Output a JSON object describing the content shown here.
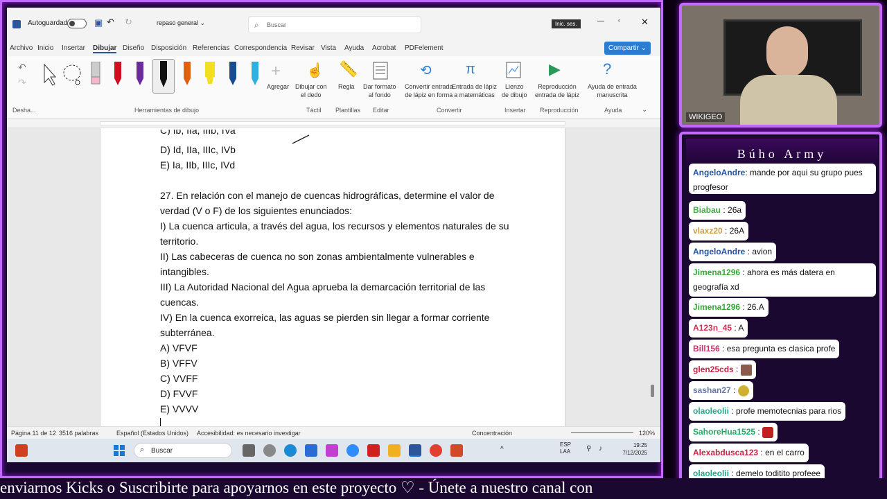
{
  "word": {
    "autosave_label": "Autoguardado",
    "doc_title": "repaso general",
    "search_placeholder": "Buscar",
    "signin_label": "Inic. ses.",
    "share_label": "Compartir",
    "menu": [
      "Archivo",
      "Inicio",
      "Insertar",
      "Dibujar",
      "Diseño",
      "Disposición",
      "Referencias",
      "Correspondencia",
      "Revisar",
      "Vista",
      "Ayuda",
      "Acrobat",
      "PDFelement"
    ],
    "ribbon": {
      "undo_group": "Desha...",
      "tools_group": "Herramientas de dibujo",
      "add_label": "Agregar",
      "draw_finger": "Dibujar con\nel dedo",
      "ruler_label": "Regla",
      "format_bg": "Dar formato\nal fondo",
      "convert_shape": "Convertir entrada\nde lápiz en forma",
      "math_input": "Entrada de lápiz\na matemáticas",
      "canvas": "Lienzo\nde dibujo",
      "replay": "Reproducción\nentrada de lápiz",
      "help_input": "Ayuda de entrada\nmanuscrita",
      "groups": [
        "Táctil",
        "Plantillas",
        "Editar",
        "Convertir",
        "Insertar",
        "Reproducción",
        "Ayuda"
      ]
    },
    "doc_lines": [
      "D) Id, IIa, IIIc, IVb",
      "E) Ia, IIb, IIIc, IVd",
      "",
      "27. En relación con el manejo de cuencas hidrográficas, determine el valor de",
      "verdad (V o F) de los siguientes enunciados:",
      "I) La cuenca articula, a través del agua, los recursos y elementos naturales de su",
      "territorio.",
      "II) Las cabeceras de cuenca no son zonas ambientalmente vulnerables e",
      "intangibles.",
      "III) La Autoridad Nacional del Agua aprueba la demarcación territorial de las",
      "cuencas.",
      "IV) En la cuenca exorreica, las aguas se pierden sin llegar a formar corriente",
      "subterránea.",
      "A) VFVF",
      "B) VFFV",
      "C) VVFF",
      "D) FVVF",
      "E) VVVV"
    ],
    "status": {
      "page": "Página 11 de 12",
      "words": "3516 palabras",
      "language": "Español (Estados Unidos)",
      "accessibility": "Accesibilidad: es necesario investigar",
      "focus": "Concentración",
      "zoom": "120%"
    },
    "taskbar": {
      "search": "Buscar",
      "lang1": "ESP",
      "lang2": "LAA",
      "time": "19:25",
      "date": "7/12/2025"
    }
  },
  "webcam": {
    "label": "WIKIGEO"
  },
  "chat": {
    "title": "Búho Army",
    "messages": [
      {
        "user": "AngeloAndre",
        "text": ": mande por aqui su grupo pues progfesor",
        "color": "#2255aa"
      },
      {
        "user": "Biabau",
        "text": ": 26a",
        "color": "#44aa44"
      },
      {
        "user": "vlaxz20",
        "text": ": 26A",
        "color": "#c8a040"
      },
      {
        "user": "AngeloAndre",
        "text": ": avion",
        "color": "#2255aa"
      },
      {
        "user": "Jimena1296",
        "text": ": ahora es más datera en geografía xd",
        "color": "#33aa33"
      },
      {
        "user": "Jimena1296",
        "text": ": 26.A",
        "color": "#33aa33"
      },
      {
        "user": "A123n_45",
        "text": ": A",
        "color": "#cc3355"
      },
      {
        "user": "Bill156",
        "text": ": esa pregunta es clasica profe",
        "color": "#cc3366"
      },
      {
        "user": "glen25cds",
        "text": ":",
        "color": "#cc2244"
      },
      {
        "user": "sashan27",
        "text": ":",
        "color": "#6677aa"
      },
      {
        "user": "olaoleolii",
        "text": ": profe memotecnias para rios",
        "color": "#22aa88"
      },
      {
        "user": "SahoreHua1525",
        "text": ":",
        "color": "#22aa66"
      },
      {
        "user": "Alexabdusca123",
        "text": ": en el carro",
        "color": "#cc2244"
      },
      {
        "user": "olaoleolii",
        "text": ": demelo toditito profeee",
        "color": "#22aa88"
      }
    ]
  },
  "ticker": {
    "text": "enviarnos Kicks o Suscribirte para apoyarnos en este proyecto ♡  -  Únete a nuestro canal con"
  }
}
